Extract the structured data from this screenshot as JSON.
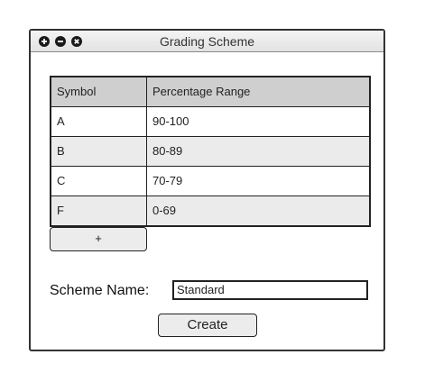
{
  "window": {
    "title": "Grading Scheme"
  },
  "table": {
    "columns": [
      "Symbol",
      "Percentage Range"
    ],
    "rows": [
      {
        "symbol": "A",
        "range": "90-100"
      },
      {
        "symbol": "B",
        "range": "80-89"
      },
      {
        "symbol": "C",
        "range": "70-79"
      },
      {
        "symbol": "F",
        "range": "0-69"
      }
    ]
  },
  "add_button": {
    "label": "+"
  },
  "scheme_name": {
    "label": "Scheme Name:",
    "value": "Standard"
  },
  "create_button": {
    "label": "Create"
  },
  "colors": {
    "header_bg": "#cfcfcf",
    "alt_row_bg": "#ebebeb",
    "border": "#222222"
  },
  "icons": [
    "plus-icon",
    "minus-icon",
    "close-icon"
  ]
}
